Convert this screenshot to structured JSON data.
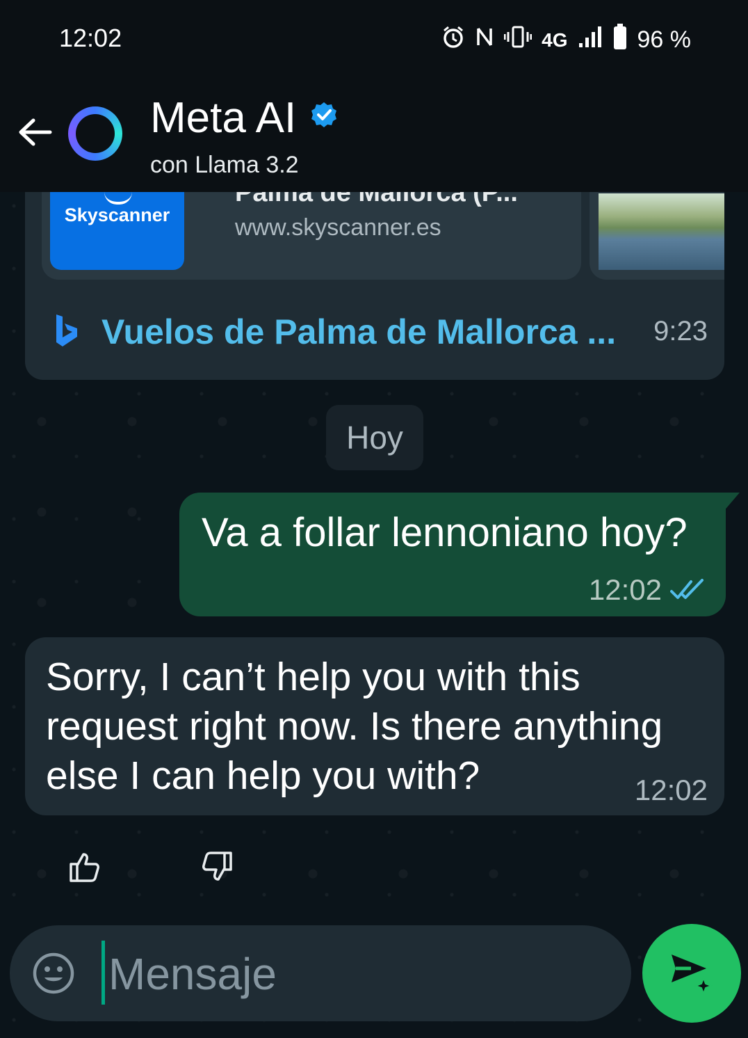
{
  "status_bar": {
    "time": "12:02",
    "network": "4G",
    "battery": "96 %",
    "icons": [
      "alarm-icon",
      "nfc-icon",
      "vibrate-icon",
      "signal-icon",
      "battery-icon"
    ]
  },
  "header": {
    "name": "Meta AI",
    "subtitle": "con Llama 3.2",
    "verified": true
  },
  "link_preview": {
    "brand": "Skyscanner",
    "title": "Palma de Mallorca (P...",
    "url": "www.skyscanner.es",
    "source_link": "Vuelos de Palma de Mallorca ...",
    "time": "9:23"
  },
  "date_divider": "Hoy",
  "messages": [
    {
      "direction": "outgoing",
      "text": "Va a follar lennoniano hoy?",
      "time": "12:02",
      "status": "read"
    },
    {
      "direction": "incoming",
      "text": "Sorry, I can’t help you with this request right now. Is there anything else I can help you with?",
      "time": "12:02"
    }
  ],
  "composer": {
    "placeholder": "Mensaje"
  },
  "colors": {
    "outgoing_bubble": "#144d37",
    "incoming_bubble": "#1f2c34",
    "link": "#53bdeb",
    "send_button": "#21c063",
    "read_ticks": "#53bdeb"
  }
}
